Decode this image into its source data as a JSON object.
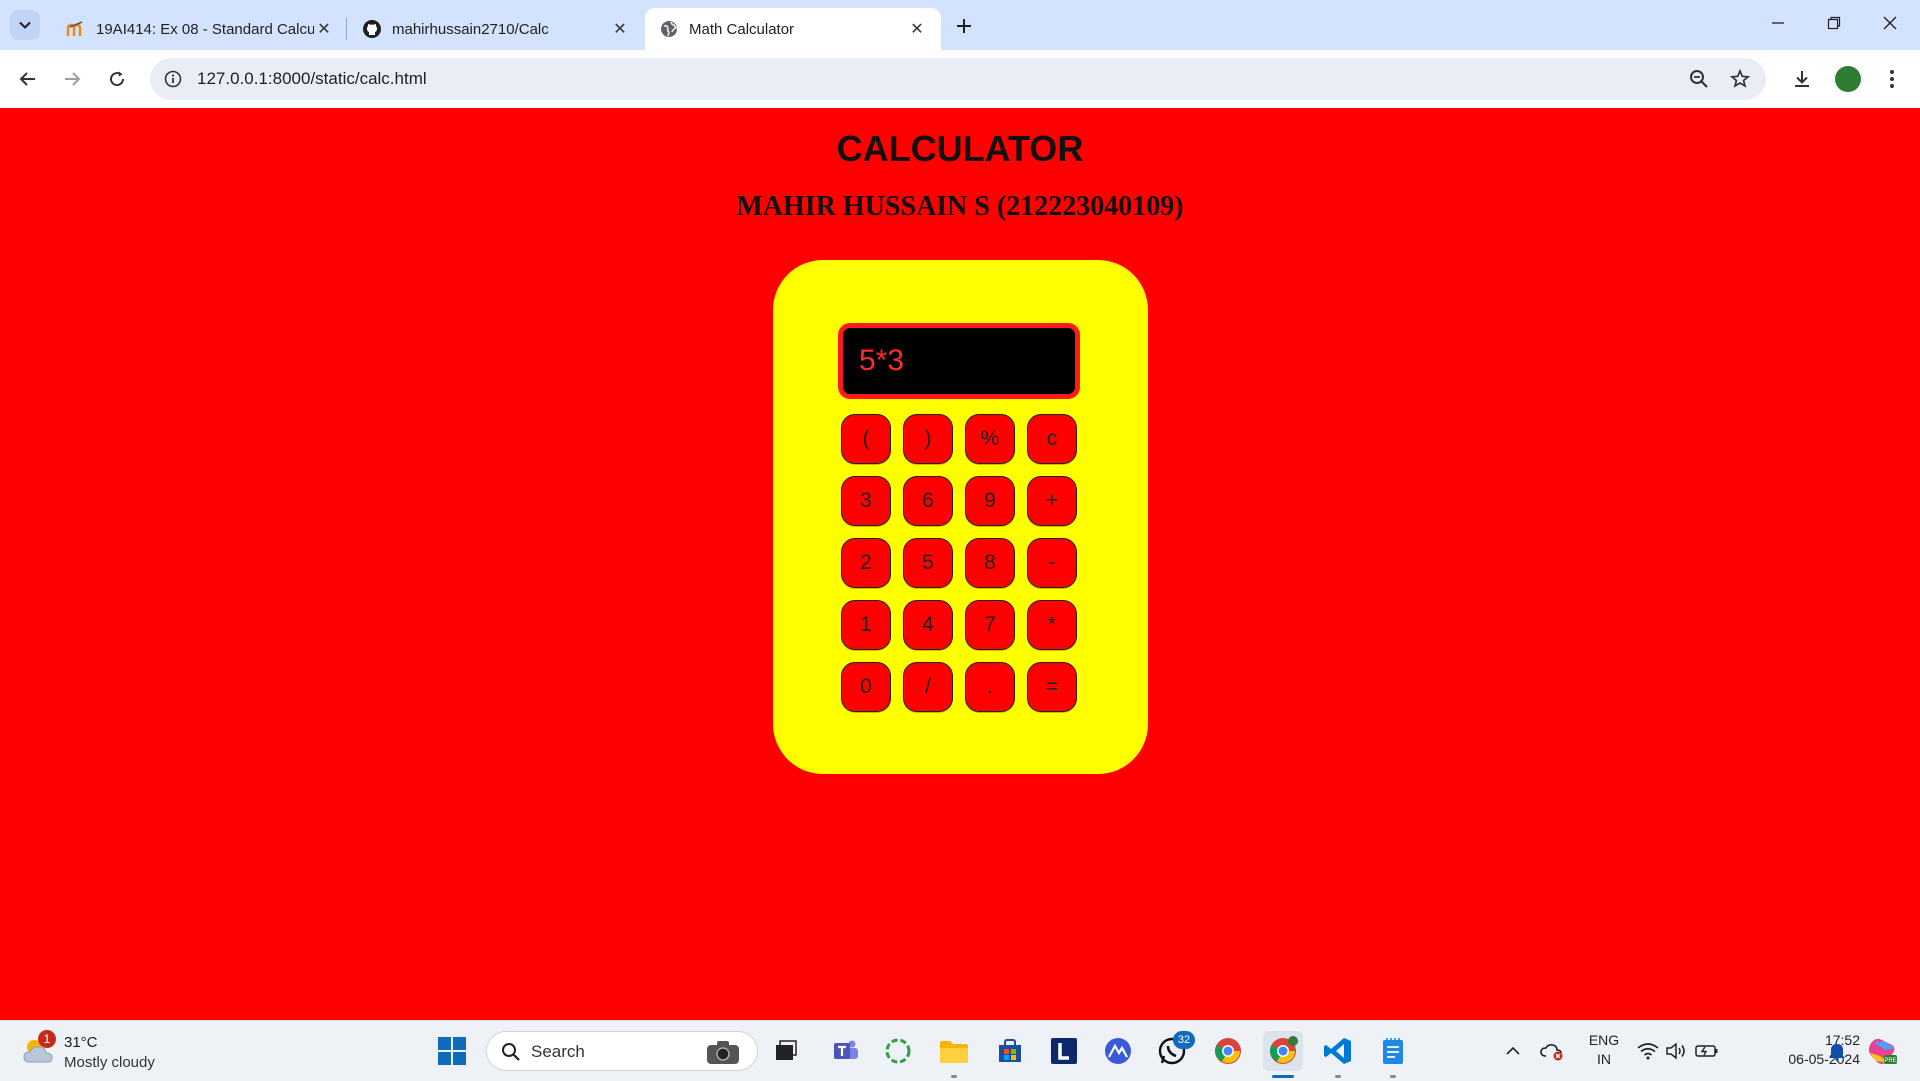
{
  "browser": {
    "tabs": [
      {
        "label": "19AI414: Ex 08 - Standard Calcu",
        "icon": "moodle-icon"
      },
      {
        "label": "mahirhussain2710/Calc",
        "icon": "github-icon"
      },
      {
        "label": "Math Calculator",
        "icon": "globe-icon",
        "active": true
      }
    ],
    "url": "127.0.0.1:8000/static/calc.html"
  },
  "page": {
    "title": "CALCULATOR",
    "subtitle": "MAHIR HUSSAIN S (212223040109)",
    "display_value": "5*3",
    "keys": [
      "(",
      ")",
      "%",
      "c",
      "3",
      "6",
      "9",
      "+",
      "2",
      "5",
      "8",
      "-",
      "1",
      "4",
      "7",
      "*",
      "0",
      "/",
      ".",
      "="
    ],
    "colors": {
      "background": "#ff0000",
      "calculator_body": "#ffff00",
      "display": "#000000",
      "display_text": "#ff2a2a",
      "keys": "#ff0000"
    }
  },
  "taskbar": {
    "weather": {
      "temp": "31°C",
      "condition": "Mostly cloudy",
      "badge": "1"
    },
    "search_label": "Search",
    "whatsapp_badge": "32",
    "language": {
      "line1": "ENG",
      "line2": "IN"
    },
    "clock": {
      "time": "17:52",
      "date": "06-05-2024"
    }
  }
}
